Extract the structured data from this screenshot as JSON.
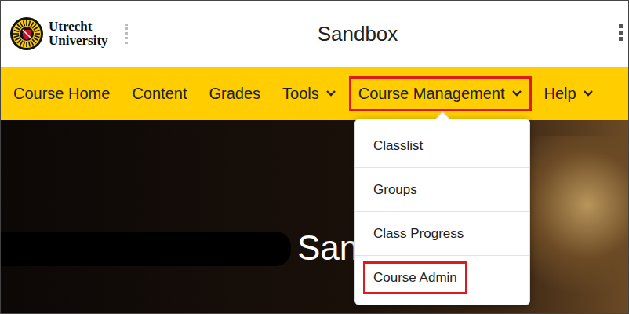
{
  "header": {
    "logo_lines": [
      "Utrecht",
      "University"
    ],
    "title": "Sandbox"
  },
  "nav": [
    {
      "label": "Course Home",
      "dropdown": false,
      "highlighted": false
    },
    {
      "label": "Content",
      "dropdown": false,
      "highlighted": false
    },
    {
      "label": "Grades",
      "dropdown": false,
      "highlighted": false
    },
    {
      "label": "Tools",
      "dropdown": true,
      "highlighted": false
    },
    {
      "label": "Course Management",
      "dropdown": true,
      "highlighted": true
    },
    {
      "label": "Help",
      "dropdown": true,
      "highlighted": false
    }
  ],
  "banner": {
    "title": "San"
  },
  "menu": [
    {
      "label": "Classlist",
      "highlighted": false
    },
    {
      "label": "Groups",
      "highlighted": false
    },
    {
      "label": "Class Progress",
      "highlighted": false
    },
    {
      "label": "Course Admin",
      "highlighted": true
    }
  ]
}
